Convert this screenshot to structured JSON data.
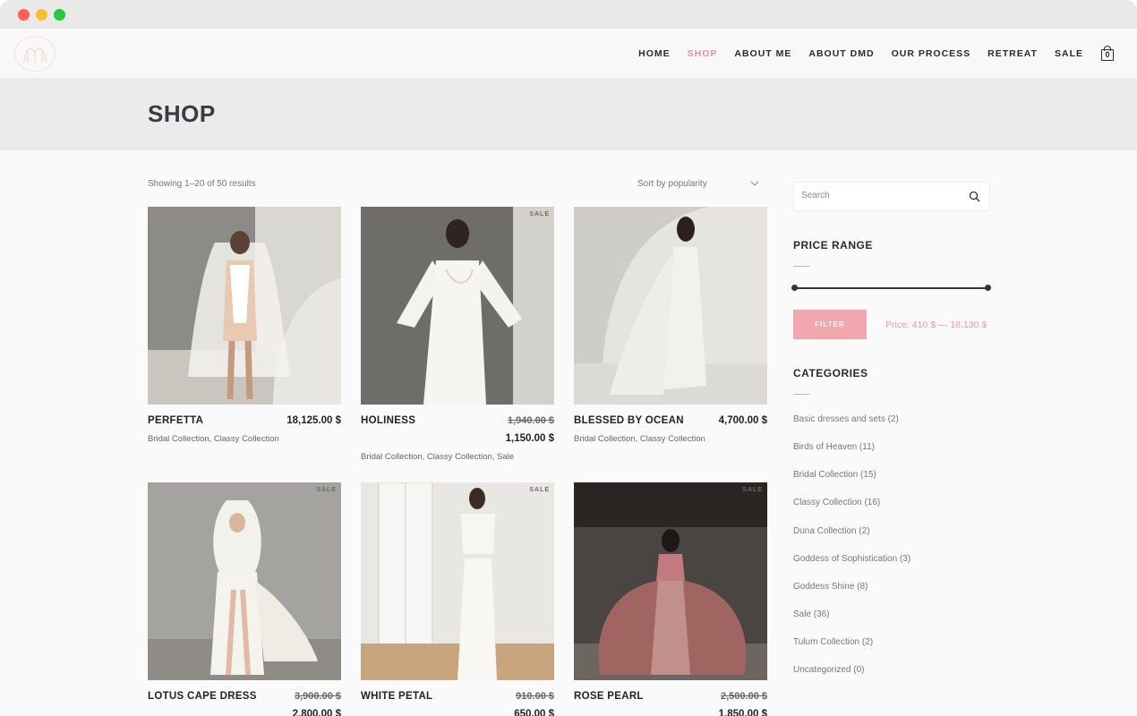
{
  "nav": {
    "items": [
      "HOME",
      "SHOP",
      "ABOUT ME",
      "ABOUT DMD",
      "OUR PROCESS",
      "RETREAT",
      "SALE"
    ],
    "active": "SHOP",
    "cart_count": "0"
  },
  "page": {
    "title": "SHOP",
    "results_text": "Showing 1–20 of 50 results",
    "sort_label": "Sort by popularity"
  },
  "products": [
    {
      "name": "PERFETTA",
      "price": "18,125.00 $",
      "old_price": "",
      "new_price": "",
      "sale": false,
      "categories": "Bridal Collection, Classy Collection"
    },
    {
      "name": "HOLINESS",
      "price": "",
      "old_price": "1,940.00 $",
      "new_price": "1,150.00 $",
      "sale": true,
      "sale_label": "SALE",
      "categories": "Bridal Collection, Classy Collection, Sale"
    },
    {
      "name": "BLESSED BY OCEAN",
      "price": "4,700.00 $",
      "old_price": "",
      "new_price": "",
      "sale": false,
      "categories": "Bridal Collection, Classy Collection"
    },
    {
      "name": "LOTUS CAPE DRESS",
      "price": "",
      "old_price": "3,900.00 $",
      "new_price": "2,800.00 $",
      "sale": true,
      "sale_label": "SALE",
      "categories": ""
    },
    {
      "name": "WHITE PETAL",
      "price": "",
      "old_price": "910.00 $",
      "new_price": "650.00 $",
      "sale": true,
      "sale_label": "SALE",
      "categories": ""
    },
    {
      "name": "ROSE PEARL",
      "price": "",
      "old_price": "2,500.00 $",
      "new_price": "1,850.00 $",
      "sale": true,
      "sale_label": "SALE",
      "categories": ""
    }
  ],
  "sidebar": {
    "search_placeholder": "Search",
    "price_range_title": "PRICE RANGE",
    "filter_label": "FILTER",
    "price_text": "Price: 410 $ — 18,130 $",
    "categories_title": "CATEGORIES",
    "categories": [
      "Basic dresses and sets (2)",
      "Birds of Heaven (11)",
      "Bridal Collection (15)",
      "Classy Collection (16)",
      "Duna Collection (2)",
      "Goddess of Sophistication (3)",
      "Goddess Shine (8)",
      "Sale (36)",
      "Tulum Collection (2)",
      "Uncategorized (0)"
    ]
  },
  "colors": {
    "accent": "#e4929b",
    "filter_button": "#f1a7ae",
    "title_band": "#ebebeb"
  }
}
